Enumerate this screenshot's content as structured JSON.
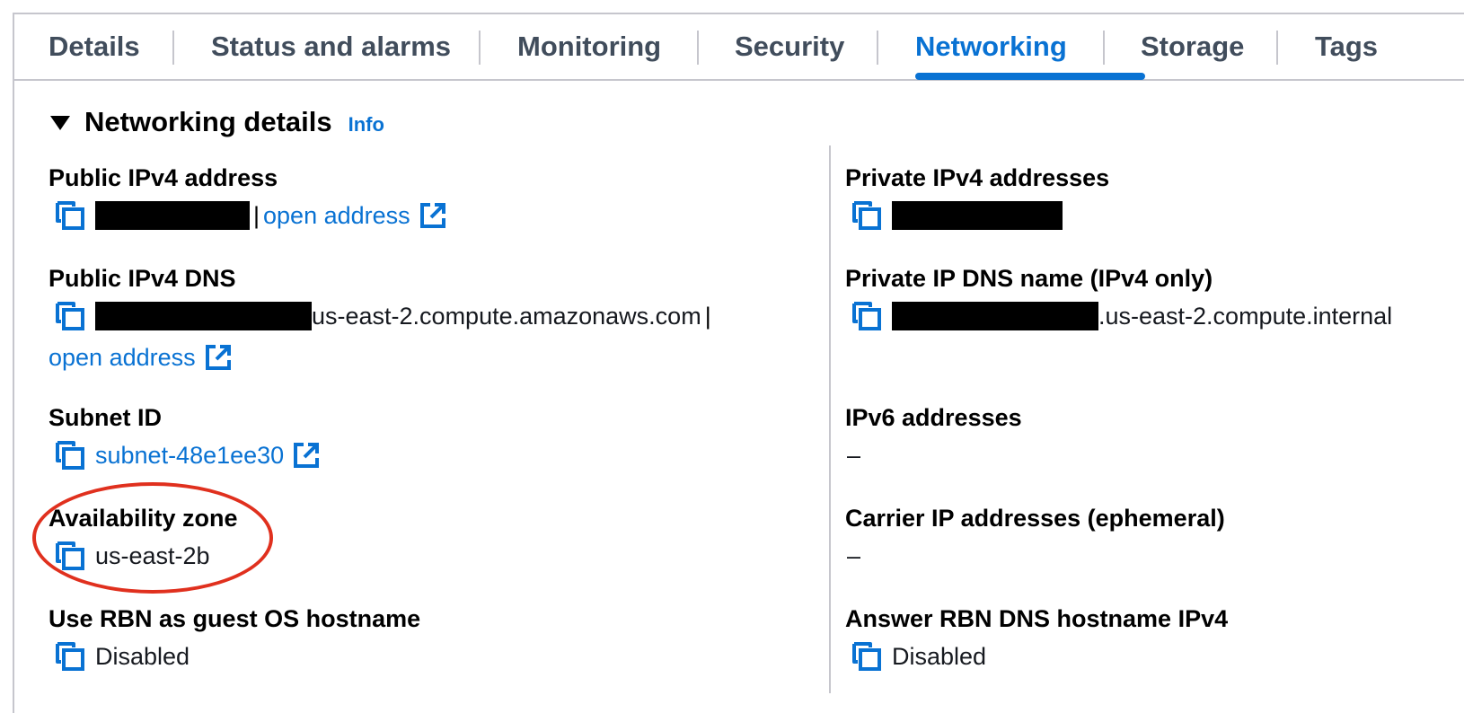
{
  "tabs": [
    {
      "label": "Details"
    },
    {
      "label": "Status and alarms"
    },
    {
      "label": "Monitoring"
    },
    {
      "label": "Security"
    },
    {
      "label": "Networking",
      "active": true
    },
    {
      "label": "Storage"
    },
    {
      "label": "Tags"
    }
  ],
  "section": {
    "title": "Networking details",
    "info_label": "Info"
  },
  "left": {
    "public_ipv4": {
      "label": "Public IPv4 address",
      "separator": "|",
      "open_address": "open address"
    },
    "public_dns": {
      "label": "Public IPv4 DNS",
      "suffix": "us-east-2.compute.amazonaws.com",
      "separator": "|",
      "open_address": "open address"
    },
    "subnet": {
      "label": "Subnet ID",
      "value": "subnet-48e1ee30"
    },
    "az": {
      "label": "Availability zone",
      "value": "us-east-2b"
    },
    "rbn_hostname": {
      "label": "Use RBN as guest OS hostname",
      "value": "Disabled"
    }
  },
  "right": {
    "private_ipv4": {
      "label": "Private IPv4 addresses"
    },
    "private_dns": {
      "label": "Private IP DNS name (IPv4 only)",
      "suffix": ".us-east-2.compute.internal"
    },
    "ipv6": {
      "label": "IPv6 addresses",
      "value": "–"
    },
    "carrier": {
      "label": "Carrier IP addresses (ephemeral)",
      "value": "–"
    },
    "rbn_dns": {
      "label": "Answer RBN DNS hostname IPv4",
      "value": "Disabled"
    }
  },
  "colors": {
    "accent": "#0972d3",
    "annotation": "#e0301e",
    "redaction": "#000000"
  },
  "icons": {
    "copy": "copy-icon",
    "external": "external-link-icon",
    "caret": "caret-down-icon"
  }
}
